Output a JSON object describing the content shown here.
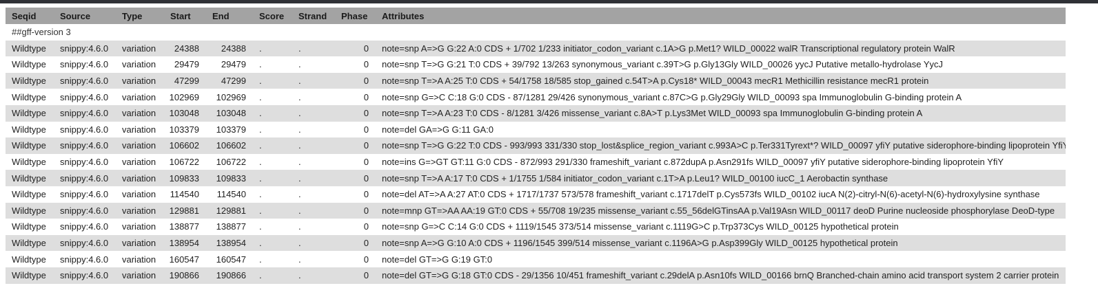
{
  "columns": [
    "Seqid",
    "Source",
    "Type",
    "Start",
    "End",
    "Score",
    "Strand",
    "Phase",
    "Attributes"
  ],
  "version_line": "##gff-version 3",
  "rows": [
    {
      "seqid": "Wildtype",
      "source": "snippy:4.6.0",
      "type": "variation",
      "start": "24388",
      "end": "24388",
      "score": ".",
      "strand": ".",
      "phase": "0",
      "attributes": "note=snp A=>G G:22 A:0 CDS + 1/702 1/233 initiator_codon_variant c.1A>G p.Met1? WILD_00022 walR Transcriptional regulatory protein WalR"
    },
    {
      "seqid": "Wildtype",
      "source": "snippy:4.6.0",
      "type": "variation",
      "start": "29479",
      "end": "29479",
      "score": ".",
      "strand": ".",
      "phase": "0",
      "attributes": "note=snp T=>G G:21 T:0 CDS + 39/792 13/263 synonymous_variant c.39T>G p.Gly13Gly WILD_00026 yycJ Putative metallo-hydrolase YycJ"
    },
    {
      "seqid": "Wildtype",
      "source": "snippy:4.6.0",
      "type": "variation",
      "start": "47299",
      "end": "47299",
      "score": ".",
      "strand": ".",
      "phase": "0",
      "attributes": "note=snp T=>A A:25 T:0 CDS + 54/1758 18/585 stop_gained c.54T>A p.Cys18* WILD_00043 mecR1 Methicillin resistance mecR1 protein"
    },
    {
      "seqid": "Wildtype",
      "source": "snippy:4.6.0",
      "type": "variation",
      "start": "102969",
      "end": "102969",
      "score": ".",
      "strand": ".",
      "phase": "0",
      "attributes": "note=snp G=>C C:18 G:0 CDS - 87/1281 29/426 synonymous_variant c.87C>G p.Gly29Gly WILD_00093 spa Immunoglobulin G-binding protein A"
    },
    {
      "seqid": "Wildtype",
      "source": "snippy:4.6.0",
      "type": "variation",
      "start": "103048",
      "end": "103048",
      "score": ".",
      "strand": ".",
      "phase": "0",
      "attributes": "note=snp T=>A A:23 T:0 CDS - 8/1281 3/426 missense_variant c.8A>T p.Lys3Met WILD_00093 spa Immunoglobulin G-binding protein A"
    },
    {
      "seqid": "Wildtype",
      "source": "snippy:4.6.0",
      "type": "variation",
      "start": "103379",
      "end": "103379",
      "score": ".",
      "strand": ".",
      "phase": "0",
      "attributes": "note=del GA=>G G:11 GA:0"
    },
    {
      "seqid": "Wildtype",
      "source": "snippy:4.6.0",
      "type": "variation",
      "start": "106602",
      "end": "106602",
      "score": ".",
      "strand": ".",
      "phase": "0",
      "attributes": "note=snp T=>G G:22 T:0 CDS - 993/993 331/330 stop_lost&splice_region_variant c.993A>C p.Ter331Tyrext*? WILD_00097 yfiY putative siderophore-binding lipoprotein YfiY"
    },
    {
      "seqid": "Wildtype",
      "source": "snippy:4.6.0",
      "type": "variation",
      "start": "106722",
      "end": "106722",
      "score": ".",
      "strand": ".",
      "phase": "0",
      "attributes": "note=ins G=>GT GT:11 G:0 CDS - 872/993 291/330 frameshift_variant c.872dupA p.Asn291fs WILD_00097 yfiY putative siderophore-binding lipoprotein YfiY"
    },
    {
      "seqid": "Wildtype",
      "source": "snippy:4.6.0",
      "type": "variation",
      "start": "109833",
      "end": "109833",
      "score": ".",
      "strand": ".",
      "phase": "0",
      "attributes": "note=snp T=>A A:17 T:0 CDS + 1/1755 1/584 initiator_codon_variant c.1T>A p.Leu1? WILD_00100 iucC_1 Aerobactin synthase"
    },
    {
      "seqid": "Wildtype",
      "source": "snippy:4.6.0",
      "type": "variation",
      "start": "114540",
      "end": "114540",
      "score": ".",
      "strand": ".",
      "phase": "0",
      "attributes": "note=del AT=>A A:27 AT:0 CDS + 1717/1737 573/578 frameshift_variant c.1717delT p.Cys573fs WILD_00102 iucA N(2)-citryl-N(6)-acetyl-N(6)-hydroxylysine synthase"
    },
    {
      "seqid": "Wildtype",
      "source": "snippy:4.6.0",
      "type": "variation",
      "start": "129881",
      "end": "129881",
      "score": ".",
      "strand": ".",
      "phase": "0",
      "attributes": "note=mnp GT=>AA AA:19 GT:0 CDS + 55/708 19/235 missense_variant c.55_56delGTinsAA p.Val19Asn WILD_00117 deoD Purine nucleoside phosphorylase DeoD-type"
    },
    {
      "seqid": "Wildtype",
      "source": "snippy:4.6.0",
      "type": "variation",
      "start": "138877",
      "end": "138877",
      "score": ".",
      "strand": ".",
      "phase": "0",
      "attributes": "note=snp G=>C C:14 G:0 CDS + 1119/1545 373/514 missense_variant c.1119G>C p.Trp373Cys WILD_00125 hypothetical protein"
    },
    {
      "seqid": "Wildtype",
      "source": "snippy:4.6.0",
      "type": "variation",
      "start": "138954",
      "end": "138954",
      "score": ".",
      "strand": ".",
      "phase": "0",
      "attributes": "note=snp A=>G G:10 A:0 CDS + 1196/1545 399/514 missense_variant c.1196A>G p.Asp399Gly WILD_00125 hypothetical protein"
    },
    {
      "seqid": "Wildtype",
      "source": "snippy:4.6.0",
      "type": "variation",
      "start": "160547",
      "end": "160547",
      "score": ".",
      "strand": ".",
      "phase": "0",
      "attributes": "note=del GT=>G G:19 GT:0"
    },
    {
      "seqid": "Wildtype",
      "source": "snippy:4.6.0",
      "type": "variation",
      "start": "190866",
      "end": "190866",
      "score": ".",
      "strand": ".",
      "phase": "0",
      "attributes": "note=del GT=>G G:18 GT:0 CDS - 29/1356 10/451 frameshift_variant c.29delA p.Asn10fs WILD_00166 brnQ Branched-chain amino acid transport system 2 carrier protein"
    }
  ]
}
